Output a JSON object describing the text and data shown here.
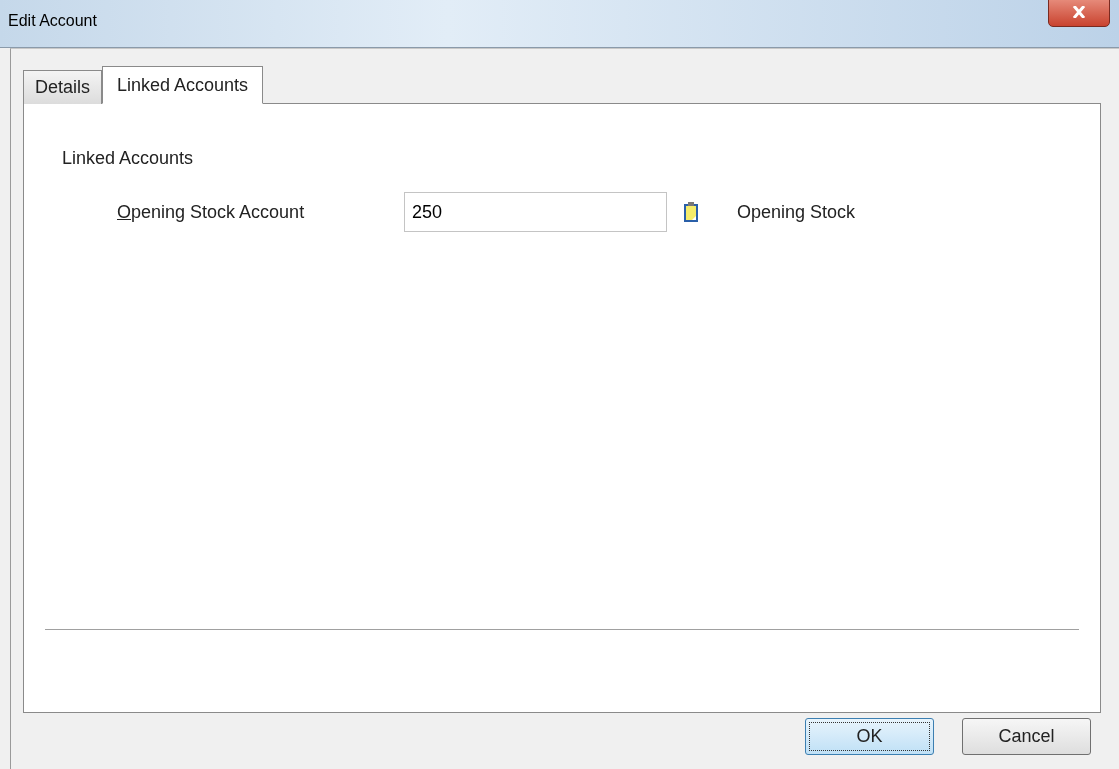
{
  "window": {
    "title": "Edit Account"
  },
  "tabs": [
    {
      "label": "Details",
      "selected": false
    },
    {
      "label": "Linked Accounts",
      "selected": true
    }
  ],
  "section": {
    "heading": "Linked Accounts"
  },
  "fields": [
    {
      "label": "Opening Stock Account",
      "value": "250",
      "description": "Opening Stock"
    }
  ],
  "buttons": [
    {
      "label": "OK",
      "default": true
    },
    {
      "label": "Cancel",
      "default": false
    }
  ]
}
